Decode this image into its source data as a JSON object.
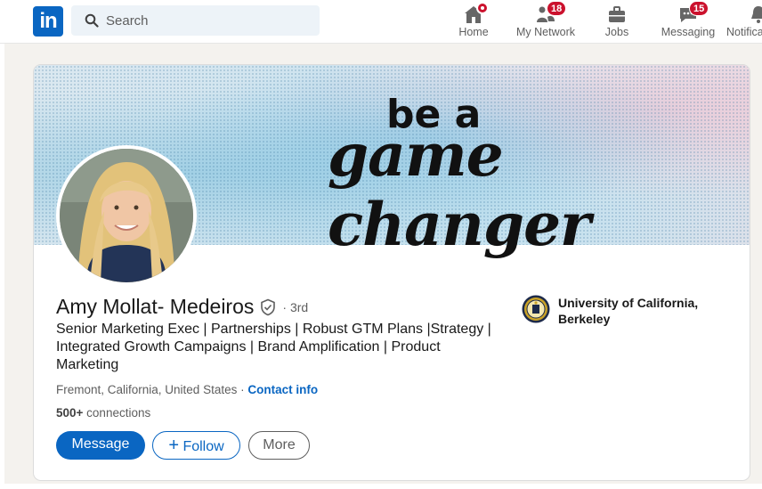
{
  "nav": {
    "logo_text": "in",
    "search_placeholder": "Search",
    "items": [
      {
        "label": "Home",
        "badge": ""
      },
      {
        "label": "My Network",
        "badge": "18"
      },
      {
        "label": "Jobs",
        "badge": ""
      },
      {
        "label": "Messaging",
        "badge": "15"
      },
      {
        "label": "Notifica",
        "badge": ""
      }
    ]
  },
  "banner": {
    "line1": "be a",
    "line2": "game changer"
  },
  "profile": {
    "name": "Amy Mollat- Medeiros",
    "degree": "· 3rd",
    "headline": "Senior Marketing Exec | Partnerships | Robust GTM Plans |Strategy | Integrated Growth Campaigns | Brand Amplification | Product Marketing",
    "location": "Fremont, California, United States",
    "separator": " · ",
    "contact_label": "Contact info",
    "connections_count": "500+",
    "connections_label": " connections",
    "education": "University of California, Berkeley"
  },
  "actions": {
    "message": "Message",
    "follow": "Follow",
    "follow_prefix": "+",
    "more": "More"
  },
  "colors": {
    "brand": "#0a66c2",
    "badge": "#cb112d"
  }
}
